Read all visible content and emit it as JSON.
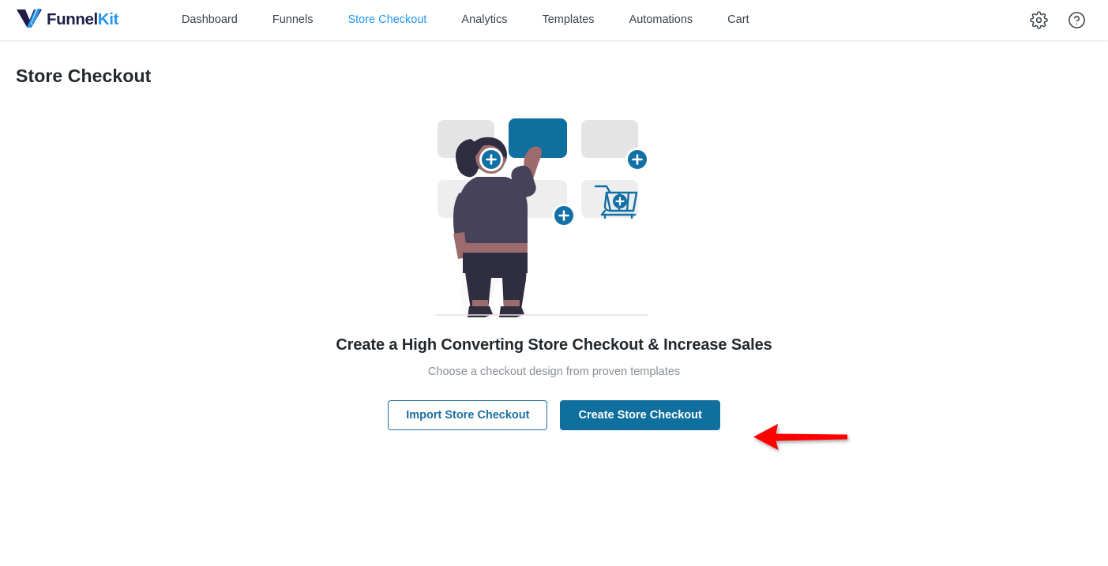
{
  "header": {
    "brand": {
      "name_part1": "Funnel",
      "name_part2": "Kit",
      "logo_icon": "funnelkit-v-logo-icon"
    },
    "nav": [
      {
        "label": "Dashboard",
        "active": false
      },
      {
        "label": "Funnels",
        "active": false
      },
      {
        "label": "Store Checkout",
        "active": true
      },
      {
        "label": "Analytics",
        "active": false
      },
      {
        "label": "Templates",
        "active": false
      },
      {
        "label": "Automations",
        "active": false
      },
      {
        "label": "Cart",
        "active": false
      }
    ],
    "actions": [
      {
        "icon": "gear-icon",
        "label": "Settings"
      },
      {
        "icon": "help-circle-icon",
        "label": "Help"
      }
    ]
  },
  "page": {
    "title": "Store Checkout"
  },
  "empty_state": {
    "illustration": "woman-arranging-checkout-blocks-illustration",
    "headline": "Create a High Converting Store Checkout & Increase Sales",
    "subtext": "Choose a checkout design from proven templates",
    "buttons": {
      "import": "Import Store Checkout",
      "create": "Create Store Checkout"
    }
  },
  "annotation": {
    "arrow": "red-left-pointing-arrow",
    "points_to": "Create Store Checkout"
  },
  "colors": {
    "brand_dark": "#1d1d47",
    "brand_blue": "#2196f3",
    "accent_blue": "#0f6f9e",
    "nav_active": "#2196f3",
    "text_primary": "#23282d",
    "text_muted": "#8a8f94",
    "illustration_gray": "#e4e4e4",
    "illustration_blue": "#0f6f9e",
    "annotation_red": "#ff0000"
  }
}
